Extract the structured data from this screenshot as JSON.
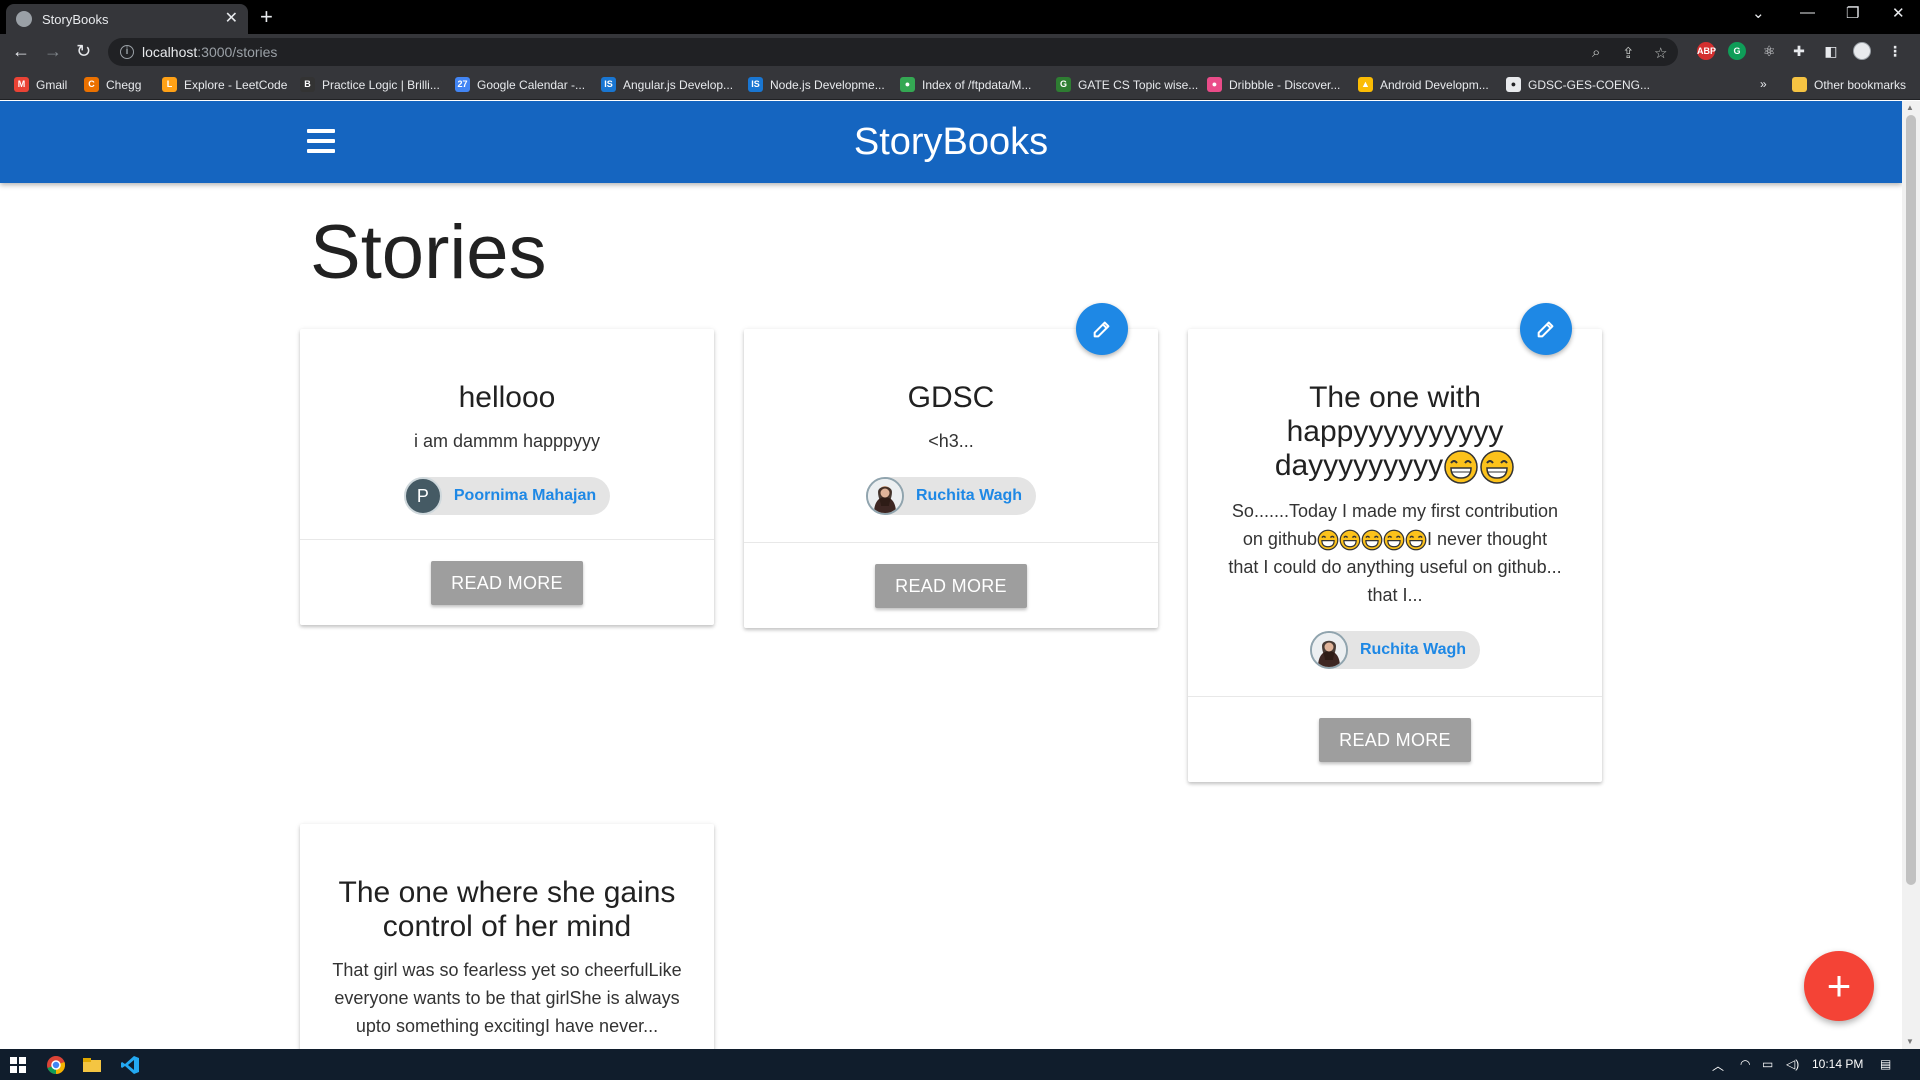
{
  "browser": {
    "tab_title": "StoryBooks",
    "tab_close": "✕",
    "new_tab": "+",
    "url_host": "localhost",
    "url_path": ":3000/stories",
    "bookmarks": [
      {
        "label": "Gmail",
        "color": "#ea4335",
        "glyph": "M"
      },
      {
        "label": "Chegg",
        "color": "#eb7100",
        "glyph": "C"
      },
      {
        "label": "Explore - LeetCode",
        "color": "#ffa116",
        "glyph": "L"
      },
      {
        "label": "Practice Logic | Brilli...",
        "color": "#333333",
        "glyph": "B"
      },
      {
        "label": "Google Calendar -...",
        "color": "#4285f4",
        "glyph": "27"
      },
      {
        "label": "Angular.js Develop...",
        "color": "#1976d2",
        "glyph": "IS"
      },
      {
        "label": "Node.js Developme...",
        "color": "#1976d2",
        "glyph": "IS"
      },
      {
        "label": "Index of /ftpdata/M...",
        "color": "#34a853",
        "glyph": "●"
      },
      {
        "label": "GATE CS Topic wise...",
        "color": "#2e7d32",
        "glyph": "G"
      },
      {
        "label": "Dribbble - Discover...",
        "color": "#ea4c89",
        "glyph": "●"
      },
      {
        "label": "Android Developm...",
        "color": "#fbbc04",
        "glyph": "▲"
      },
      {
        "label": "GDSC-GES-COENG...",
        "color": "#e8eaed",
        "glyph": "●"
      }
    ],
    "bookmarks_more": "»",
    "other_bookmarks": "Other bookmarks"
  },
  "app": {
    "brand": "StoryBooks",
    "page_title": "Stories",
    "add_button": "+"
  },
  "stories": [
    {
      "title": "hellooo",
      "body": "i am dammm happpyyy",
      "author": "Poornima Mahajan",
      "avatar_letter": "P",
      "read_more": "READ MORE",
      "editable": false
    },
    {
      "title": "GDSC",
      "body": "<h3...",
      "author": "Ruchita Wagh",
      "read_more": "READ MORE",
      "editable": true
    },
    {
      "title_line1": "The one with",
      "title_line2": "happyyyyyyyyyy",
      "title_line3": "dayyyyyyyyy",
      "body_line1": "So.......Today I made my first contribution",
      "body_line2_pre": "on github",
      "body_line2_post": "I never thought",
      "body_line3": "that I could do anything useful on github...",
      "body_line4": "that I...",
      "author": "Ruchita Wagh",
      "read_more": "READ MORE",
      "editable": true
    },
    {
      "title": "The one where she gains control of her mind",
      "body": "That girl was so fearless yet so cheerfulLike everyone wants to be that girlShe is always upto something excitingI have never...",
      "editable": false
    }
  ],
  "taskbar": {
    "time": "10:14 PM"
  },
  "colors": {
    "appbar": "#1565c0",
    "accent_blue": "#1e88e5",
    "fab_red": "#f44336",
    "read_more_grey": "#9e9e9e"
  }
}
